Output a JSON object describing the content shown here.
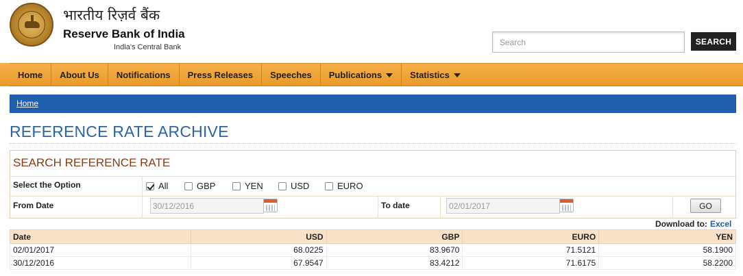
{
  "header": {
    "hindi_name": "भारतीय रिज़र्व बैंक",
    "bank_name": "Reserve Bank of India",
    "tagline": "India's Central Bank",
    "search_placeholder": "Search",
    "search_button": "SEARCH"
  },
  "nav": [
    {
      "label": "Home"
    },
    {
      "label": "About Us"
    },
    {
      "label": "Notifications"
    },
    {
      "label": "Press Releases"
    },
    {
      "label": "Speeches"
    },
    {
      "label": "Publications",
      "dropdown": true
    },
    {
      "label": "Statistics",
      "dropdown": true
    }
  ],
  "breadcrumb": {
    "home": "Home"
  },
  "page_title": "REFERENCE RATE ARCHIVE",
  "search_panel": {
    "title": "SEARCH REFERENCE RATE",
    "option_label": "Select the Option",
    "options": [
      {
        "label": "All",
        "checked": true
      },
      {
        "label": "GBP",
        "checked": false
      },
      {
        "label": "YEN",
        "checked": false
      },
      {
        "label": "USD",
        "checked": false
      },
      {
        "label": "EURO",
        "checked": false
      }
    ],
    "from_label": "From Date",
    "from_value": "30/12/2016",
    "to_label": "To date",
    "to_value": "02/01/2017",
    "go_label": "GO"
  },
  "download": {
    "label": "Download to:",
    "link": "Excel"
  },
  "table": {
    "headers": [
      "Date",
      "USD",
      "GBP",
      "EURO",
      "YEN"
    ],
    "rows": [
      [
        "02/01/2017",
        "68.0225",
        "83.9670",
        "71.5121",
        "58.1900"
      ],
      [
        "30/12/2016",
        "67.9547",
        "83.4212",
        "71.6175",
        "58.2200"
      ]
    ]
  },
  "colors": {
    "nav_orange": "#f0a53a",
    "breadcrumb_blue": "#1f5fae",
    "title_blue": "#2a64a8",
    "panel_title_brown": "#8c3b12",
    "table_header": "#f8e1c7"
  }
}
